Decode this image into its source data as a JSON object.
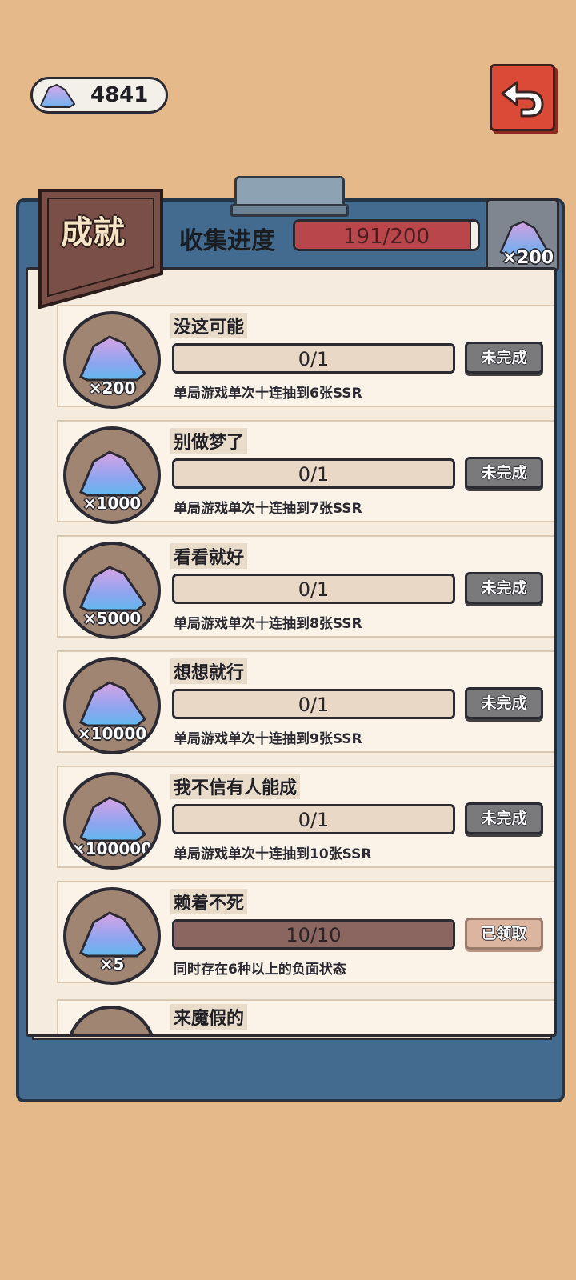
{
  "currency": {
    "amount": "4841",
    "icon": "crystal-icon"
  },
  "header": {
    "title": "成就",
    "collect_label": "收集进度",
    "progress_text": "191/200",
    "progress_fraction": 0.955,
    "reward_qty": "×200"
  },
  "achievements": [
    {
      "name": "没这可能",
      "reward": "×200",
      "progress": "0/1",
      "fraction": 0,
      "desc": "单局游戏单次十连抽到6张SSR",
      "status": "未完成"
    },
    {
      "name": "别做梦了",
      "reward": "×1000",
      "progress": "0/1",
      "fraction": 0,
      "desc": "单局游戏单次十连抽到7张SSR",
      "status": "未完成"
    },
    {
      "name": "看看就好",
      "reward": "×5000",
      "progress": "0/1",
      "fraction": 0,
      "desc": "单局游戏单次十连抽到8张SSR",
      "status": "未完成"
    },
    {
      "name": "想想就行",
      "reward": "×10000",
      "progress": "0/1",
      "fraction": 0,
      "desc": "单局游戏单次十连抽到9张SSR",
      "status": "未完成"
    },
    {
      "name": "我不信有人能成",
      "reward": "×100000",
      "progress": "0/1",
      "fraction": 0,
      "desc": "单局游戏单次十连抽到10张SSR",
      "status": "未完成"
    },
    {
      "name": "赖着不死",
      "reward": "×5",
      "progress": "10/10",
      "fraction": 1,
      "desc": "同时存在6种以上的负面状态",
      "status": "已领取"
    }
  ],
  "partial_row": {
    "name": "来魔假的"
  }
}
